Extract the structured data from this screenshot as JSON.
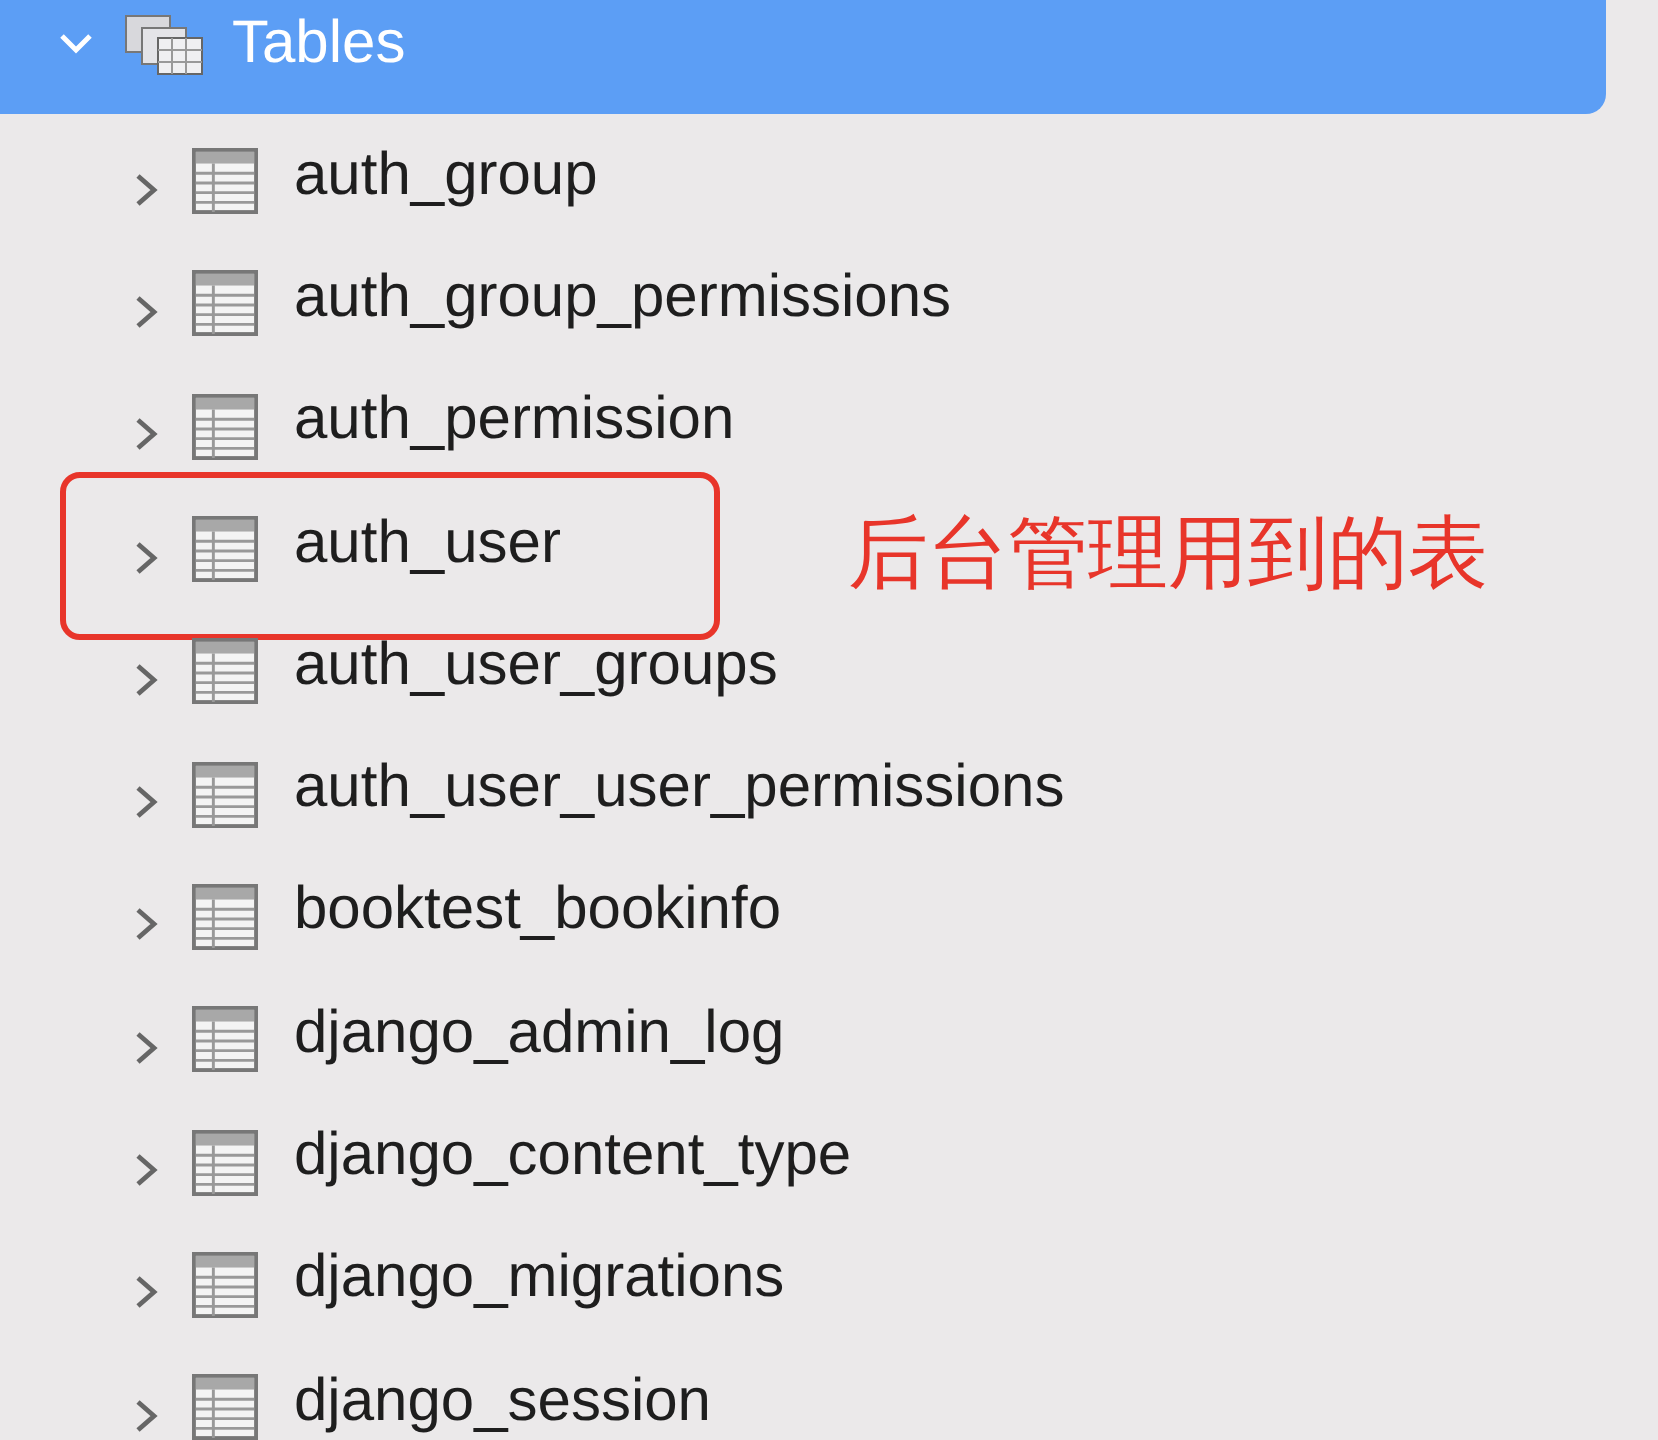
{
  "tree": {
    "label": "Tables",
    "expanded": true,
    "selected": true,
    "children": [
      {
        "label": "auth_group",
        "expanded": false,
        "selected": false,
        "annotated": false
      },
      {
        "label": "auth_group_permissions",
        "expanded": false,
        "selected": false,
        "annotated": false
      },
      {
        "label": "auth_permission",
        "expanded": false,
        "selected": false,
        "annotated": false
      },
      {
        "label": "auth_user",
        "expanded": false,
        "selected": false,
        "annotated": true
      },
      {
        "label": "auth_user_groups",
        "expanded": false,
        "selected": false,
        "annotated": false
      },
      {
        "label": "auth_user_user_permissions",
        "expanded": false,
        "selected": false,
        "annotated": false
      },
      {
        "label": "booktest_bookinfo",
        "expanded": false,
        "selected": false,
        "annotated": false
      },
      {
        "label": "django_admin_log",
        "expanded": false,
        "selected": false,
        "annotated": false
      },
      {
        "label": "django_content_type",
        "expanded": false,
        "selected": false,
        "annotated": false
      },
      {
        "label": "django_migrations",
        "expanded": false,
        "selected": false,
        "annotated": false
      },
      {
        "label": "django_session",
        "expanded": false,
        "selected": false,
        "annotated": false
      }
    ]
  },
  "annotation": {
    "label": "后台管理用到的表"
  }
}
